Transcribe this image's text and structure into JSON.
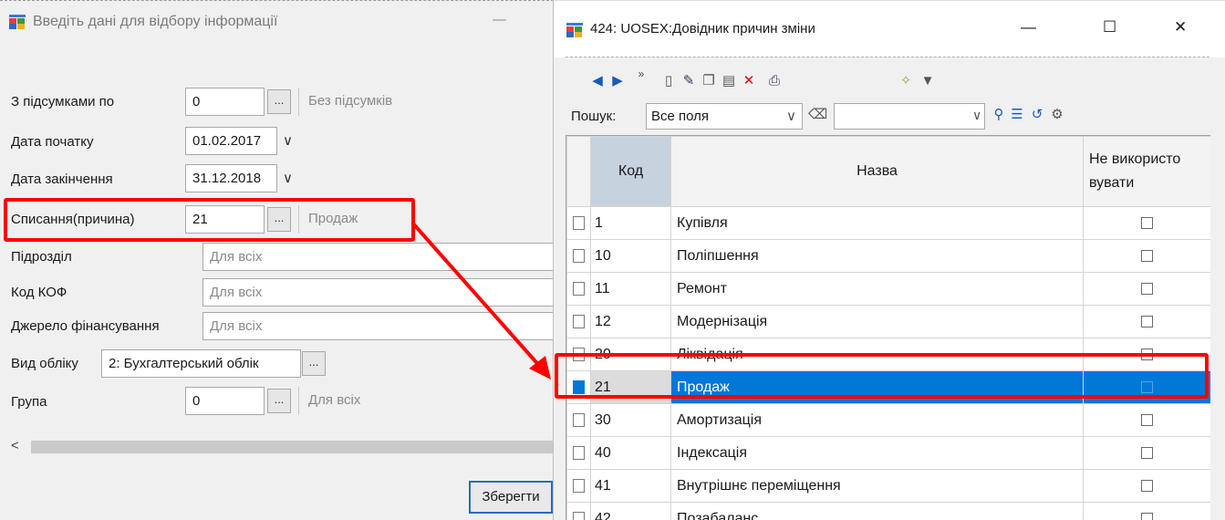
{
  "left_dialog": {
    "title": "Введіть дані для відбору інформації",
    "minimize_glyph": "—",
    "fields": {
      "totals_label": "З підсумками по",
      "totals_value": "0",
      "totals_note": "Без підсумків",
      "start_label": "Дата початку",
      "start_value": "01.02.2017",
      "end_label": "Дата закінчення",
      "end_value": "31.12.2018",
      "writeoff_label": "Списання(причина)",
      "writeoff_value": "21",
      "writeoff_note": "Продаж",
      "dept_label": "Підрозділ",
      "dept_value": "Для всіх",
      "kof_label": "Код КОФ",
      "kof_value": "Для всіх",
      "source_label": "Джерело фінансування",
      "source_value": "Для всіх",
      "accounting_label": "Вид обліку",
      "accounting_value": "2: Бухгалтерський облік",
      "group_label": "Група",
      "group_value": "0",
      "group_note": "Для всіх"
    },
    "ellipsis": "...",
    "dropdown_glyph": "∨",
    "scroll_left_glyph": "<",
    "save_button": "Зберегти"
  },
  "right_window": {
    "title": "424: UOSEX:Довідник причин зміни",
    "controls": {
      "minimize": "—",
      "maximize": "☐",
      "close": "✕"
    },
    "toolbar": {
      "search_label": "Пошук:",
      "search_scope": "Все поля",
      "search_value": "",
      "more_glyph": "»"
    },
    "columns": [
      "Код",
      "Назва",
      "Не використо вувати"
    ],
    "rows": [
      {
        "code": "1",
        "name": "Купівля"
      },
      {
        "code": "10",
        "name": "Поліпшення"
      },
      {
        "code": "11",
        "name": "Ремонт"
      },
      {
        "code": "12",
        "name": "Модернізація"
      },
      {
        "code": "20",
        "name": "Ліквідація"
      },
      {
        "code": "21",
        "name": "Продаж"
      },
      {
        "code": "30",
        "name": "Амортизація"
      },
      {
        "code": "40",
        "name": "Індексація"
      },
      {
        "code": "41",
        "name": "Внутрішнє переміщення"
      },
      {
        "code": "42",
        "name": "Позабаланс"
      }
    ],
    "selected_code": "21"
  },
  "colors": {
    "highlight": "#ff0000",
    "selection": "#0078d7"
  }
}
